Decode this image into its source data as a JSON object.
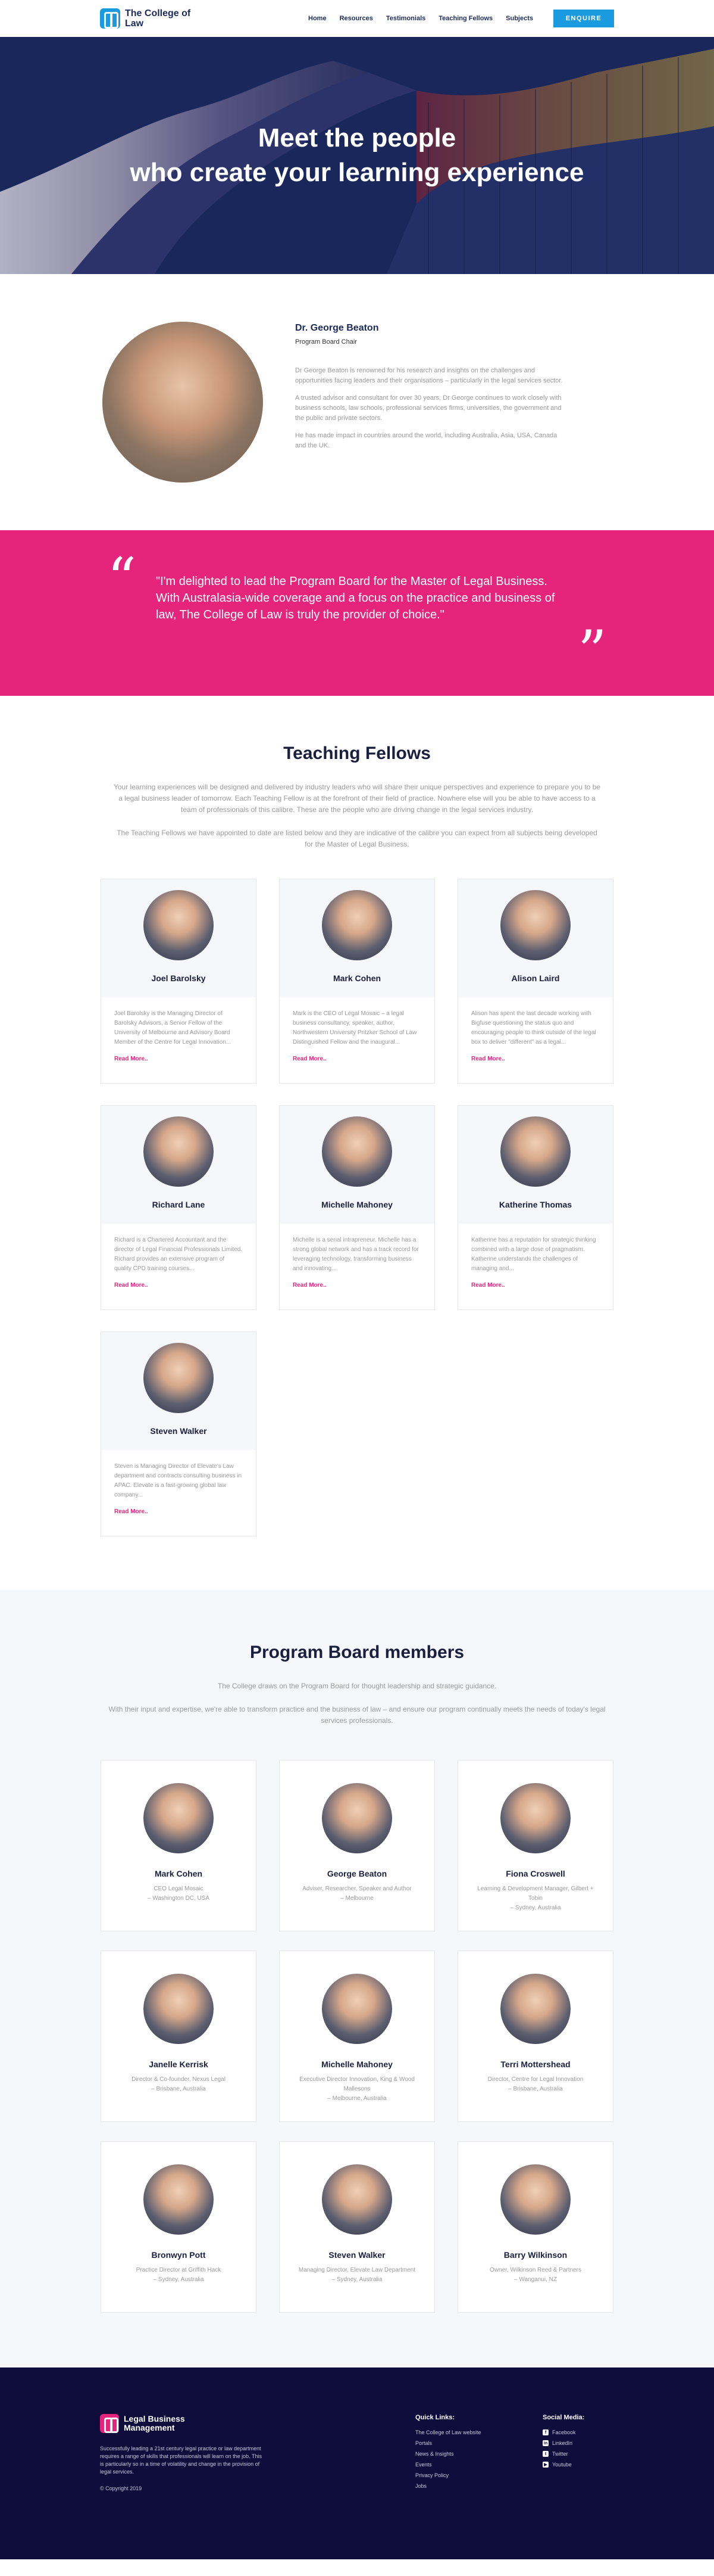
{
  "header": {
    "logo_text": "The College of Law",
    "nav": [
      "Home",
      "Resources",
      "Testimonials",
      "Teaching Fellows",
      "Subjects"
    ],
    "cta": "ENQUIRE"
  },
  "hero": {
    "line1": "Meet the people",
    "line2": "who create your learning experience"
  },
  "profile": {
    "name": "Dr. George Beaton",
    "role": "Program Board Chair",
    "paragraphs": [
      "Dr George Beaton is renowned for his research and insights on the challenges and opportunities facing leaders and their organisations – particularly in the legal services sector.",
      "A trusted advisor and consultant for over 30 years, Dr George continues to work closely with business schools, law schools, professional services firms, universities, the government and the public and private sectors.",
      "He has made impact in countries around the world, including Australia, Asia, USA, Canada and the UK."
    ]
  },
  "quote": {
    "text": "\"I'm delighted to lead the Program Board for the Master of Legal Business. With Australasia-wide coverage and a focus on the practice and business of law, The College of Law is truly the provider of choice.\""
  },
  "fellows": {
    "title": "Teaching Fellows",
    "intro1": "Your learning experiences will be designed and delivered by industry leaders who will share their unique perspectives and experience to prepare you to be a legal business leader of tomorrow. Each Teaching Fellow is at the forefront of their field of practice. Nowhere else will you be able to have access to a team of professionals of this calibre. These are the people who are driving change in the legal services industry.",
    "intro2": "The Teaching Fellows we have appointed to date are listed below and they are indicative of the calibre you can expect from all subjects being developed for the Master of Legal Business.",
    "read_more": "Read More..",
    "items": [
      {
        "name": "Joel Barolsky",
        "bio": "Joel Barolsky is the Managing Director of Barolsky Advisors, a Senior Fellow of the University of Melbourne and Advisory Board Member of the Centre for Legal Innovation..."
      },
      {
        "name": "Mark Cohen",
        "bio": "Mark is the CEO of Legal Mosaic – a legal business consultancy, speaker, author, Northwestern University Pritzker School of Law Distinguished Fellow and the inaugural..."
      },
      {
        "name": "Alison Laird",
        "bio": "Alison has spent the last decade working with Bigfuse questioning the status quo and encouraging people to think outside of the legal box to deliver \"different\" as a legal..."
      },
      {
        "name": "Richard Lane",
        "bio": "Richard is a Chartered Accountant and the director of Legal Financial Professionals Limited. Richard provides an extensive program of quality CPD training courses..."
      },
      {
        "name": "Michelle Mahoney",
        "bio": "Michelle is a serial intrapreneur. Michelle has a strong global network and has a track record for leveraging technology, transforming business and innovating..."
      },
      {
        "name": "Katherine Thomas",
        "bio": "Katherine has a reputation for strategic thinking combined with a large dose of pragmatism. Katherine understands the challenges of managing and..."
      },
      {
        "name": "Steven Walker",
        "bio": "Steven is Managing Director of Elevate's Law department and contracts consulting business in APAC. Elevate is a fast-growing global law company..."
      }
    ]
  },
  "board": {
    "title": "Program Board members",
    "intro1": "The College draws on the Program Board for thought leadership and strategic guidance.",
    "intro2": "With their input and expertise, we're able to transform practice and the business of law – and ensure our program continually meets the needs of today's legal services professionals.",
    "items": [
      {
        "name": "Mark Cohen",
        "role": "CEO Legal Mosaic",
        "location": "– Washington DC, USA"
      },
      {
        "name": "George Beaton",
        "role": "Adviser, Researcher, Speaker and Author",
        "location": "– Melbourne"
      },
      {
        "name": "Fiona Croswell",
        "role": "Learning & Development Manager, Gilbert + Tobin",
        "location": "– Sydney, Australia"
      },
      {
        "name": "Janelle Kerrisk",
        "role": "Director & Co-founder, Nexus Legal",
        "location": "– Brisbane, Australia"
      },
      {
        "name": "Michelle Mahoney",
        "role": "Executive Director Innovation, King & Wood Mallesons",
        "location": "– Melbourne, Australia"
      },
      {
        "name": "Terri Mottershead",
        "role": "Director, Centre for Legal Innovation",
        "location": "– Brisbane, Australia"
      },
      {
        "name": "Bronwyn Pott",
        "role": "Practice Director at Griffith Hack",
        "location": "– Sydney, Australia"
      },
      {
        "name": "Steven Walker",
        "role": "Managing Director, Elevate Law Department",
        "location": "– Sydney, Australia"
      },
      {
        "name": "Barry Wilkinson",
        "role": "Owner, Wilkinson Reed & Partners",
        "location": "– Wanganui, NZ"
      }
    ]
  },
  "footer": {
    "logo_text": "Legal Business Management",
    "description": "Successfully leading a 21st century legal practice or law department requires a range of skills that professionals will learn on the job. This is particularly so in a time of volatility and change in the provision of legal services.",
    "copyright": "© Copyright 2019",
    "quick_title": "Quick Links:",
    "quick_links": [
      "The College of Law website",
      "Portals",
      "News & Insights",
      "Events",
      "Privacy Policy",
      "Jobs"
    ],
    "social_title": "Social Media:",
    "social": [
      {
        "label": "Facebook",
        "glyph": "f"
      },
      {
        "label": "LinkedIn",
        "glyph": "in"
      },
      {
        "label": "Twitter",
        "glyph": "t"
      },
      {
        "label": "Youtube",
        "glyph": "▶"
      }
    ]
  }
}
